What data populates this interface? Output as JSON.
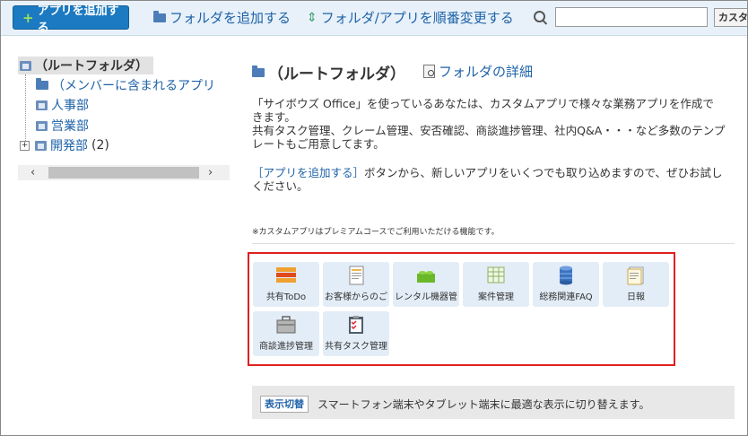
{
  "toolbar": {
    "add_app": "アプリを追加する",
    "add_folder": "フォルダを追加する",
    "reorder": "フォルダ/アプリを順番変更する",
    "search_placeholder": "",
    "search_button": "カスタ"
  },
  "tree": {
    "root": "（ルートフォルダ）",
    "items": [
      {
        "label": "（メンバーに含まれるアプリ",
        "icon": "folder-icon"
      },
      {
        "label": "人事部",
        "icon": "app-icon"
      },
      {
        "label": "営業部",
        "icon": "app-icon"
      },
      {
        "label": "開発部",
        "count": "(2)",
        "icon": "app-icon",
        "expandable": true
      }
    ],
    "scroll_left": "‹",
    "scroll_right": "›"
  },
  "main": {
    "title": "（ルートフォルダ）",
    "detail_link": "フォルダの詳細",
    "desc1_line1": "「サイボウズ Office」を使っているあなたは、カスタムアプリで様々な業務アプリを作成で",
    "desc1_line2": "きます。",
    "desc1_line3": "共有タスク管理、クレーム管理、安否確認、商談進捗管理、社内Q&A・・・など多数のテンプ",
    "desc1_line4": "レートもご用意してます。",
    "desc2_link": "［アプリを追加する］",
    "desc2_rest": "ボタンから、新しいアプリをいくつでも取り込めますので、ぜひお試し",
    "desc2_line2": "ください。",
    "note": "※カスタムアプリはプレミアムコースでご利用いただける機能です。",
    "apps": [
      {
        "label": "共有ToDo",
        "icon": "todo-stack-icon"
      },
      {
        "label": "お客様からのご",
        "icon": "document-icon"
      },
      {
        "label": "レンタル機器管",
        "icon": "lego-block-icon"
      },
      {
        "label": "案件管理",
        "icon": "spreadsheet-icon"
      },
      {
        "label": "総務関連FAQ",
        "icon": "database-icon"
      },
      {
        "label": "日報",
        "icon": "notepad-icon"
      },
      {
        "label": "商談進捗管理",
        "icon": "briefcase-icon"
      },
      {
        "label": "共有タスク管理",
        "icon": "clipboard-checklist-icon"
      }
    ],
    "switch_button": "表示切替",
    "switch_text": "スマートフォン端末やタブレット端末に最適な表示に切り替えます。"
  },
  "colors": {
    "accent": "#1b7ac1",
    "link": "#1e62a8",
    "highlight_border": "#e02020",
    "tile_bg": "#e3edf7"
  }
}
